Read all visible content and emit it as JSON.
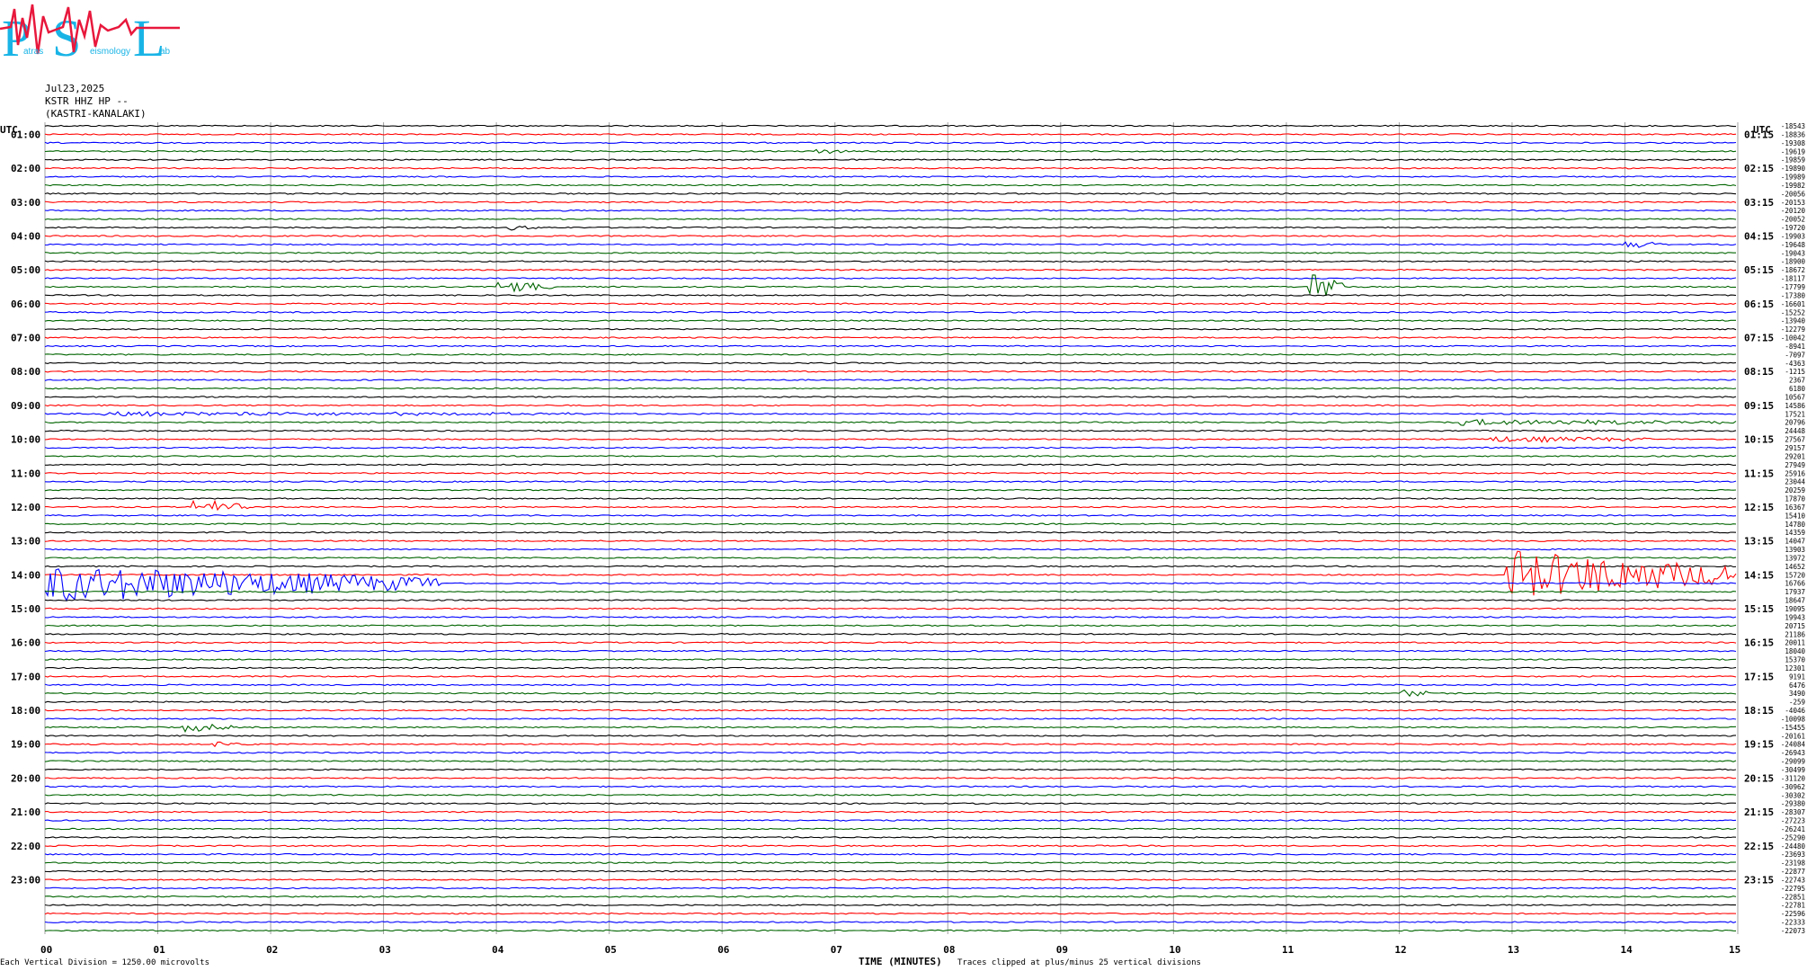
{
  "logo": {
    "letters": [
      "P",
      "S",
      "L"
    ],
    "words": [
      "atras",
      "eismology",
      "ab"
    ]
  },
  "header": {
    "date": "Jul23,2025",
    "channel": "KSTR HHZ HP --",
    "site": "(KASTRI-KANALAKI)",
    "utc_left": "UTC",
    "utc_right": "UTC"
  },
  "footer": {
    "scale": "Each Vertical Division = 1250.00 microvolts",
    "xlabel": "TIME (MINUTES)",
    "clip": "Traces clipped at plus/minus 25 vertical divisions"
  },
  "colors": {
    "cycle": [
      "#000000",
      "#ff0000",
      "#0000ff",
      "#006400"
    ],
    "grid": "#a0a0a0"
  },
  "chart_data": {
    "type": "line",
    "x_ticks": [
      "00",
      "01",
      "02",
      "03",
      "04",
      "05",
      "06",
      "07",
      "08",
      "09",
      "10",
      "11",
      "12",
      "13",
      "14",
      "15"
    ],
    "xlim": [
      0,
      15
    ],
    "hour_labels_left": [
      "01:00",
      "02:00",
      "03:00",
      "04:00",
      "05:00",
      "06:00",
      "07:00",
      "08:00",
      "09:00",
      "10:00",
      "11:00",
      "12:00",
      "13:00",
      "14:00",
      "15:00",
      "16:00",
      "17:00",
      "18:00",
      "19:00",
      "20:00",
      "21:00",
      "22:00",
      "23:00"
    ],
    "hour_labels_right": [
      "01:15",
      "02:15",
      "03:15",
      "04:15",
      "05:15",
      "06:15",
      "07:15",
      "08:15",
      "09:15",
      "10:15",
      "11:15",
      "12:15",
      "13:15",
      "14:15",
      "15:15",
      "16:15",
      "17:15",
      "18:15",
      "19:15",
      "20:15",
      "21:15",
      "22:15",
      "23:15"
    ],
    "trace_offsets": [
      "-18543",
      "-18836",
      "-19308",
      "-19619",
      "-19859",
      "-19890",
      "-19989",
      "-19982",
      "-20056",
      "-20153",
      "-20120",
      "-20052",
      "-19720",
      "-19903",
      "-19648",
      "-19043",
      "-18900",
      "-18672",
      "-18117",
      "-17799",
      "-17380",
      "-16601",
      "-15252",
      "-13940",
      "-12279",
      "-10042",
      "-8941",
      "-7097",
      "-4363",
      "-1215",
      "2367",
      "6180",
      "10567",
      "14586",
      "17521",
      "20796",
      "24448",
      "27567",
      "29157",
      "29201",
      "27949",
      "25916",
      "23044",
      "20259",
      "17870",
      "16367",
      "15410",
      "14780",
      "14359",
      "14047",
      "13903",
      "13972",
      "14652",
      "15720",
      "16766",
      "17937",
      "18647",
      "19095",
      "19943",
      "20715",
      "21186",
      "20011",
      "18040",
      "15370",
      "12301",
      "9191",
      "6476",
      "3490",
      "-259",
      "-4046",
      "-10098",
      "-15455",
      "-20161",
      "-24084",
      "-26943",
      "-29099",
      "-30499",
      "-31120",
      "-30962",
      "-30302",
      "-29380",
      "-28307",
      "-27223",
      "-26241",
      "-25290",
      "-24480",
      "-23693",
      "-23198",
      "-22877",
      "-22743",
      "-22795",
      "-22851",
      "-22781",
      "-22596",
      "-22333",
      "-22073"
    ],
    "events": [
      {
        "trace": 3,
        "minute": 6.8,
        "amplitude": 0.35,
        "duration": 0.3
      },
      {
        "trace": 12,
        "minute": 4.1,
        "amplitude": 0.3,
        "duration": 0.25
      },
      {
        "trace": 14,
        "minute": 14.0,
        "amplitude": 0.45,
        "duration": 0.35
      },
      {
        "trace": 19,
        "minute": 4.0,
        "amplitude": 0.7,
        "duration": 0.5
      },
      {
        "trace": 19,
        "minute": 11.2,
        "amplitude": 2.4,
        "duration": 0.3
      },
      {
        "trace": 34,
        "minute": 0.5,
        "amplitude": 0.25,
        "duration": 4.5
      },
      {
        "trace": 35,
        "minute": 12.5,
        "amplitude": 0.35,
        "duration": 2.5
      },
      {
        "trace": 37,
        "minute": 12.8,
        "amplitude": 0.35,
        "duration": 1.5
      },
      {
        "trace": 45,
        "minute": 1.3,
        "amplitude": 0.9,
        "duration": 0.5
      },
      {
        "trace": 54,
        "minute": 0.0,
        "amplitude": 2.2,
        "duration": 3.5
      },
      {
        "trace": 53,
        "minute": 12.95,
        "amplitude": 3.0,
        "duration": 2.05
      },
      {
        "trace": 67,
        "minute": 12.0,
        "amplitude": 0.5,
        "duration": 0.3
      },
      {
        "trace": 71,
        "minute": 1.2,
        "amplitude": 0.55,
        "duration": 0.45
      },
      {
        "trace": 73,
        "minute": 1.5,
        "amplitude": 0.25,
        "duration": 0.4
      }
    ]
  }
}
